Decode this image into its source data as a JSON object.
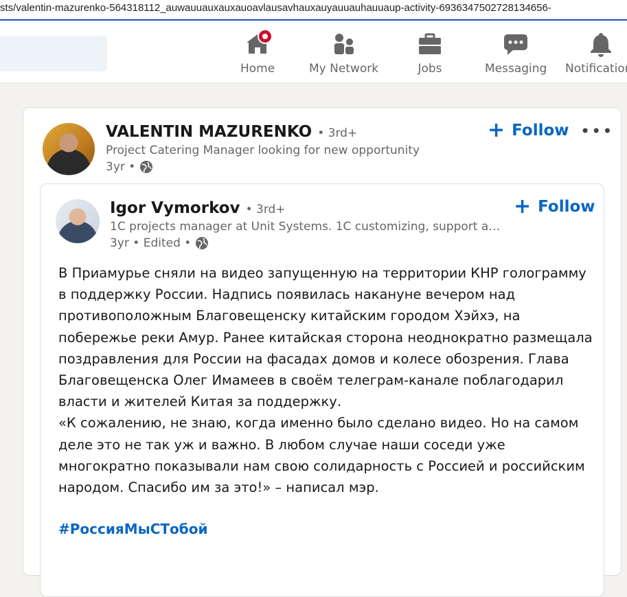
{
  "browser": {
    "url": "sts/valentin-mazurenko-564318112_auwauuauxauxauoavlausavhauxauyauuauhauuaup-activity-6936347502728134656-"
  },
  "nav": {
    "items": [
      {
        "label": "Home",
        "icon": "home-icon"
      },
      {
        "label": "My Network",
        "icon": "network-icon"
      },
      {
        "label": "Jobs",
        "icon": "briefcase-icon"
      },
      {
        "label": "Messaging",
        "icon": "messaging-icon"
      },
      {
        "label": "Notifications",
        "icon": "bell-icon"
      }
    ]
  },
  "post": {
    "author": "VALENTIN MAZURENKO",
    "degree": "• 3rd+",
    "headline": "Project Catering Manager looking for new opportunity",
    "time": "3yr •",
    "follow_label": "Follow",
    "more": "•••"
  },
  "reshared": {
    "author": "Igor Vymorkov",
    "degree": "• 3rd+",
    "headline": "1C projects manager at Unit Systems. 1C customizing, support and ...",
    "time": "3yr • Edited •",
    "follow_label": "Follow",
    "paragraph1": "В Приамурье сняли на видео запущенную на территории КНР голограмму в поддержку России. Надпись появилась накануне вечером над противоположным Благовещенску китайским городом Хэйхэ, на побережье реки Амур. Ранее китайская сторона неоднократно размещала поздравления для России на фасадах домов и колесе обозрения. Глава Благовещенска Олег Имамеев в своём телеграм-канале поблагодарил власти и жителей Китая за поддержку.",
    "paragraph2": "«К сожалению, не знаю, когда именно было сделано видео. Но на самом деле это не так уж и важно. В любом случае наши соседи уже многократно показывали нам свою солидарность с Россией и российским народом. Спасибо им за это!» – написал мэр.",
    "hashtag": "#РоссияМыСТобой"
  },
  "colors": {
    "accent": "#0a66c2",
    "badge": "#cb112d",
    "page_bg": "#f4f2ee"
  }
}
